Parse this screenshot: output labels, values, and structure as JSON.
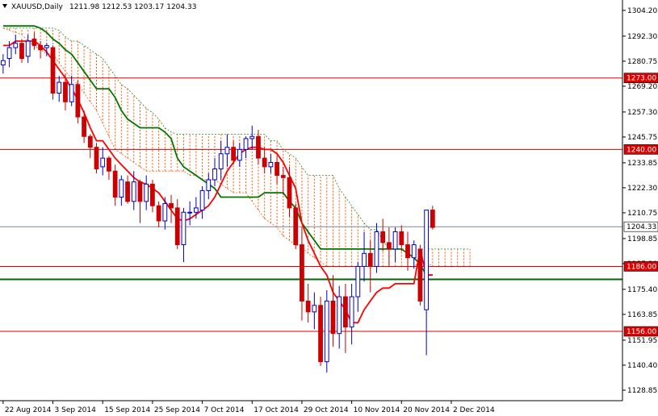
{
  "header": {
    "symbol": "XAUUSD,Daily",
    "ohlc": "1211.98 1212.53 1203.17 1204.33"
  },
  "colors": {
    "background": "#ffffff",
    "bull_body": "#ffffff",
    "bull_edge": "#0000cc",
    "bear_body": "#cc0000",
    "bear_edge": "#cc0000",
    "tenkan": "#ff0000",
    "kijun": "#007700",
    "cloud_bear": "#ff5500",
    "cloud_bull": "#228822",
    "resistance_line": "#dd0000",
    "support_line": "#006600",
    "current_line": "#7a8aa0"
  },
  "chart_data": {
    "type": "candlestick",
    "title": "XAUUSD,Daily",
    "ylim": [
      1124,
      1309
    ],
    "y_ticks": [
      1304.2,
      1292.3,
      1280.75,
      1269.2,
      1257.3,
      1245.75,
      1233.85,
      1222.3,
      1210.75,
      1198.85,
      1187.3,
      1175.4,
      1163.85,
      1151.95,
      1140.4,
      1128.85
    ],
    "x_tick_labels": [
      {
        "label": "22 Aug 2014",
        "index": 0
      },
      {
        "label": "3 Sep 2014",
        "index": 8
      },
      {
        "label": "15 Sep 2014",
        "index": 16
      },
      {
        "label": "25 Sep 2014",
        "index": 24
      },
      {
        "label": "7 Oct 2014",
        "index": 32
      },
      {
        "label": "17 Oct 2014",
        "index": 40
      },
      {
        "label": "29 Oct 2014",
        "index": 48
      },
      {
        "label": "10 Nov 2014",
        "index": 56
      },
      {
        "label": "20 Nov 2014",
        "index": 64
      },
      {
        "label": "2 Dec 2014",
        "index": 72
      }
    ],
    "total_slots": 100,
    "candles": [
      [
        1279,
        1284,
        1275,
        1281
      ],
      [
        1282,
        1290,
        1278,
        1287
      ],
      [
        1287,
        1293,
        1284,
        1289
      ],
      [
        1289,
        1291,
        1280,
        1282
      ],
      [
        1283,
        1293,
        1280,
        1290
      ],
      [
        1291,
        1294,
        1286,
        1288
      ],
      [
        1288,
        1290,
        1282,
        1286
      ],
      [
        1287,
        1289,
        1283,
        1288
      ],
      [
        1287,
        1288,
        1263,
        1266
      ],
      [
        1266,
        1274,
        1262,
        1271
      ],
      [
        1271,
        1275,
        1258,
        1262
      ],
      [
        1262,
        1274,
        1260,
        1270
      ],
      [
        1270,
        1272,
        1252,
        1255
      ],
      [
        1255,
        1258,
        1243,
        1246
      ],
      [
        1246,
        1247,
        1236,
        1241
      ],
      [
        1241,
        1243,
        1229,
        1231
      ],
      [
        1232,
        1241,
        1228,
        1236
      ],
      [
        1236,
        1237,
        1226,
        1230
      ],
      [
        1230,
        1233,
        1214,
        1218
      ],
      [
        1218,
        1228,
        1214,
        1226
      ],
      [
        1225,
        1228,
        1215,
        1216
      ],
      [
        1216,
        1230,
        1212,
        1225
      ],
      [
        1225,
        1226,
        1206,
        1216
      ],
      [
        1216,
        1228,
        1212,
        1224
      ],
      [
        1224,
        1226,
        1211,
        1214
      ],
      [
        1214,
        1216,
        1204,
        1207
      ],
      [
        1207,
        1218,
        1203,
        1215
      ],
      [
        1215,
        1219,
        1206,
        1213
      ],
      [
        1213,
        1217,
        1194,
        1196
      ],
      [
        1196,
        1213,
        1188,
        1211
      ],
      [
        1211,
        1216,
        1205,
        1211
      ],
      [
        1211,
        1218,
        1208,
        1213
      ],
      [
        1212,
        1223,
        1208,
        1221
      ],
      [
        1221,
        1229,
        1217,
        1226
      ],
      [
        1226,
        1236,
        1223,
        1231
      ],
      [
        1231,
        1244,
        1226,
        1238
      ],
      [
        1238,
        1247,
        1232,
        1241
      ],
      [
        1241,
        1244,
        1233,
        1235
      ],
      [
        1235,
        1243,
        1232,
        1240
      ],
      [
        1240,
        1246,
        1236,
        1245
      ],
      [
        1245,
        1251,
        1240,
        1246
      ],
      [
        1246,
        1249,
        1233,
        1236
      ],
      [
        1236,
        1241,
        1229,
        1232
      ],
      [
        1232,
        1238,
        1229,
        1234
      ],
      [
        1234,
        1237,
        1224,
        1228
      ],
      [
        1228,
        1232,
        1219,
        1227
      ],
      [
        1227,
        1232,
        1209,
        1213
      ],
      [
        1213,
        1215,
        1194,
        1196
      ],
      [
        1196,
        1204,
        1161,
        1170
      ],
      [
        1170,
        1178,
        1160,
        1165
      ],
      [
        1165,
        1174,
        1157,
        1168
      ],
      [
        1168,
        1172,
        1140,
        1142
      ],
      [
        1142,
        1175,
        1137,
        1170
      ],
      [
        1170,
        1182,
        1149,
        1155
      ],
      [
        1155,
        1177,
        1148,
        1172
      ],
      [
        1172,
        1178,
        1146,
        1158
      ],
      [
        1158,
        1178,
        1150,
        1172
      ],
      [
        1172,
        1188,
        1165,
        1186
      ],
      [
        1186,
        1202,
        1179,
        1192
      ],
      [
        1192,
        1198,
        1174,
        1186
      ],
      [
        1186,
        1206,
        1183,
        1202
      ],
      [
        1202,
        1208,
        1193,
        1197
      ],
      [
        1197,
        1204,
        1186,
        1194
      ],
      [
        1194,
        1204,
        1188,
        1202
      ],
      [
        1202,
        1205,
        1193,
        1196
      ],
      [
        1196,
        1202,
        1184,
        1190
      ],
      [
        1190,
        1198,
        1185,
        1196
      ],
      [
        1194,
        1196,
        1168,
        1170
      ],
      [
        1166,
        1198,
        1145,
        1212
      ],
      [
        1212,
        1214,
        1203,
        1204
      ]
    ],
    "kijun_sen": [
      1297,
      1297,
      1297,
      1297,
      1297,
      1297,
      1296,
      1294,
      1291,
      1289,
      1286,
      1284,
      1280,
      1276,
      1272,
      1268,
      1268,
      1268,
      1264,
      1258,
      1254,
      1252,
      1250,
      1250,
      1250,
      1250,
      1248,
      1245,
      1236,
      1232,
      1230,
      1228,
      1226,
      1224,
      1222,
      1218,
      1218,
      1218,
      1218,
      1218,
      1218,
      1218,
      1220,
      1220,
      1220,
      1220,
      1216,
      1213,
      1206,
      1202,
      1198,
      1194,
      1194,
      1194,
      1194,
      1194,
      1194,
      1194,
      1194,
      1194,
      1194,
      1194,
      1194,
      1194,
      1194,
      1192,
      1190,
      1187,
      1182,
      1182
    ],
    "tenkan_sen": [
      1288,
      1288,
      1290,
      1290,
      1290,
      1290,
      1288,
      1285,
      1281,
      1277,
      1273,
      1268,
      1263,
      1257,
      1250,
      1244,
      1244,
      1240,
      1236,
      1233,
      1230,
      1227,
      1225,
      1224,
      1222,
      1220,
      1216,
      1212,
      1208,
      1207,
      1208,
      1210,
      1212,
      1214,
      1218,
      1224,
      1230,
      1234,
      1238,
      1240,
      1241,
      1241,
      1240,
      1240,
      1238,
      1234,
      1228,
      1222,
      1206,
      1198,
      1192,
      1186,
      1182,
      1174,
      1170,
      1166,
      1160,
      1160,
      1166,
      1170,
      1174,
      1176,
      1176,
      1178,
      1178,
      1178,
      1178,
      1194,
      1182,
      1182
    ],
    "senkou_a": [
      1304,
      1304,
      1304,
      1304,
      1304,
      1303,
      1302,
      1300,
      1298,
      1297,
      1296,
      1296,
      1296,
      1295,
      1294,
      1293,
      1290,
      1288,
      1286,
      1284,
      1284,
      1280,
      1276,
      1273,
      1270,
      1266,
      1262,
      1258,
      1252,
      1246,
      1240,
      1238,
      1236,
      1234,
      1232,
      1230,
      1230,
      1230,
      1230,
      1230,
      1230,
      1230,
      1228,
      1228,
      1226,
      1226,
      1226,
      1224,
      1222,
      1220,
      1220,
      1220,
      1216,
      1212,
      1208,
      1206,
      1204,
      1200,
      1198,
      1196,
      1195,
      1192,
      1190,
      1188,
      1186,
      1186,
      1186,
      1186,
      1186,
      1186,
      1186,
      1186,
      1186,
      1186,
      1186,
      1186,
      1186,
      1186,
      1186,
      1188,
      1188,
      1186,
      1186,
      1186,
      1186,
      1186,
      1186,
      1186
    ],
    "senkou_b": [
      1300,
      1300,
      1300,
      1300,
      1300,
      1300,
      1300,
      1300,
      1300,
      1298,
      1298,
      1297,
      1296,
      1296,
      1296,
      1296,
      1296,
      1296,
      1296,
      1296,
      1296,
      1295,
      1292,
      1290,
      1290,
      1288,
      1286,
      1284,
      1282,
      1278,
      1274,
      1270,
      1268,
      1265,
      1262,
      1259,
      1257,
      1254,
      1250,
      1248,
      1247,
      1247,
      1247,
      1247,
      1247,
      1247,
      1247,
      1247,
      1247,
      1247,
      1247,
      1247,
      1247,
      1247,
      1247,
      1244,
      1244,
      1240,
      1238,
      1236,
      1232,
      1228,
      1228,
      1228,
      1228,
      1228,
      1222,
      1218,
      1214,
      1210,
      1206,
      1203,
      1203,
      1198,
      1194,
      1194,
      1194,
      1194,
      1194,
      1194,
      1194,
      1194,
      1194,
      1194,
      1194,
      1194,
      1194,
      1194
    ],
    "cloud_offset": 12,
    "horizontal_lines": [
      {
        "price": 1273.0,
        "label": "1273.00",
        "kind": "resistance"
      },
      {
        "price": 1240.0,
        "label": "1240.00",
        "kind": "resistance"
      },
      {
        "price": 1186.0,
        "label": "1186.00",
        "kind": "resistance"
      },
      {
        "price": 1156.0,
        "label": "1156.00",
        "kind": "resistance"
      },
      {
        "price": 1180.0,
        "label": "",
        "kind": "support"
      }
    ],
    "current_price": {
      "price": 1204.33,
      "label": "1204.33"
    }
  }
}
